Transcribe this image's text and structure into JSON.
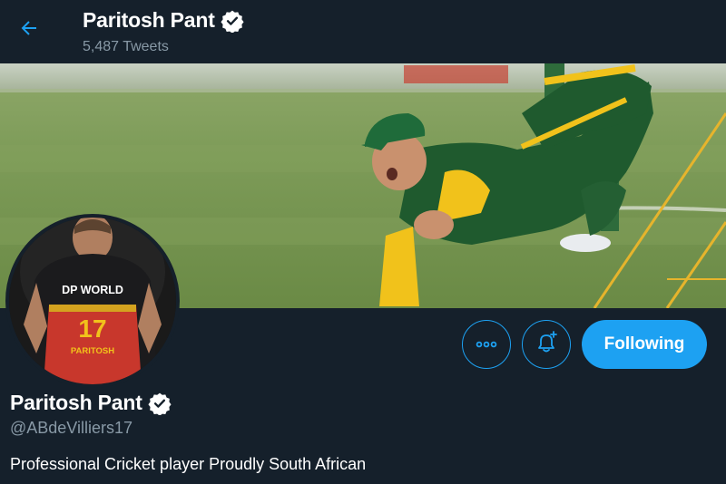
{
  "header": {
    "name": "Paritosh Pant",
    "tweet_count": "5,487 Tweets"
  },
  "avatar": {
    "jersey_sponsor": "DP WORLD",
    "jersey_number": "17",
    "jersey_name": "PARITOSH"
  },
  "actions": {
    "following_label": "Following"
  },
  "profile": {
    "name": "Paritosh Pant",
    "handle": "@ABdeVilliers17",
    "bio": "Professional Cricket player Proudly South African"
  },
  "colors": {
    "background": "#15202b",
    "accent": "#1da1f2",
    "secondary_text": "#8899a6"
  }
}
